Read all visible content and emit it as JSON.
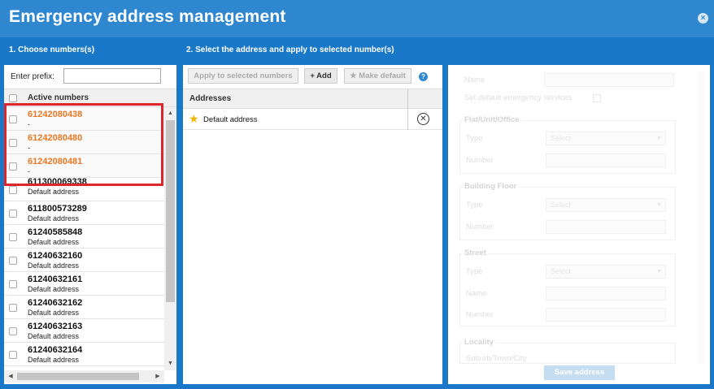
{
  "window": {
    "title": "Emergency address management",
    "close_glyph": "×"
  },
  "steps": {
    "step1": "1. Choose numbers(s)",
    "step2": "2. Select the address and apply to selected number(s)"
  },
  "left": {
    "prefix_label": "Enter prefix:",
    "prefix_value": "",
    "column_header": "Active numbers",
    "rows": [
      {
        "number": "61242080438",
        "address": "-",
        "selected": true
      },
      {
        "number": "61242080480",
        "address": "-",
        "selected": true
      },
      {
        "number": "61242080481",
        "address": "-",
        "selected": true
      },
      {
        "number": "611300069338",
        "address": "Default address",
        "selected": false
      },
      {
        "number": "611800573289",
        "address": "Default address",
        "selected": false
      },
      {
        "number": "61240585848",
        "address": "Default address",
        "selected": false
      },
      {
        "number": "61240632160",
        "address": "Default address",
        "selected": false
      },
      {
        "number": "61240632161",
        "address": "Default address",
        "selected": false
      },
      {
        "number": "61240632162",
        "address": "Default address",
        "selected": false
      },
      {
        "number": "61240632163",
        "address": "Default address",
        "selected": false
      },
      {
        "number": "61240632164",
        "address": "Default address",
        "selected": false
      }
    ]
  },
  "middle": {
    "apply_label": "Apply to selected numbers",
    "add_label": "+ Add",
    "make_default_label": "★ Make default",
    "help_glyph": "?",
    "column_header": "Addresses",
    "addresses": [
      {
        "label": "Default address",
        "icon": "star-icon",
        "remove_glyph": "✕"
      }
    ]
  },
  "right": {
    "name_label": "Name",
    "default_services_label": "Set default emergency services",
    "flat_title": "Flat/Unit/Office",
    "building_title": "Building Floor",
    "street_title": "Street",
    "locality_title": "Locality",
    "type_label": "Type",
    "number_label": "Number",
    "street_name_label": "Name",
    "suburb_label": "Suburb/Town/City",
    "select_placeholder": "Select",
    "save_label": "Save address"
  },
  "colors": {
    "title_bar": "#2f87d0",
    "body_bg": "#1a78c8",
    "selected_number": "#e87722",
    "highlight": "#e0242c"
  }
}
